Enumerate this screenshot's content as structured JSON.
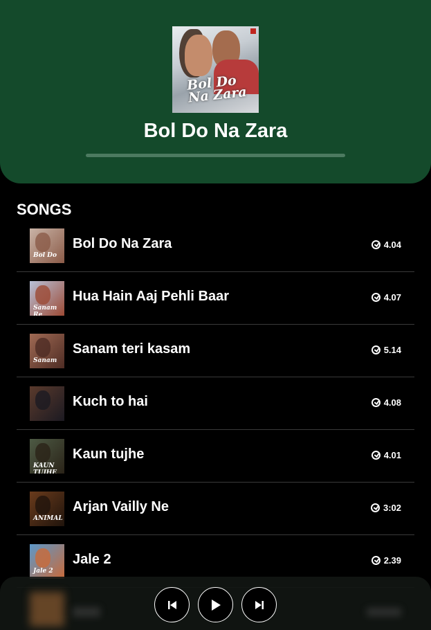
{
  "album": {
    "title": "Bol Do Na Zara",
    "cover_title": "Bol Do Na Zara",
    "progress_fraction": 0.0
  },
  "section": {
    "title": "SONGS"
  },
  "songs": [
    {
      "name": "Bol Do Na Zara",
      "duration": "4.04",
      "thumb_colors": [
        "#c9b3a6",
        "#8b5b48"
      ],
      "thumb_text": "Bol Do"
    },
    {
      "name": "Hua Hain Aaj Pehli Baar",
      "duration": "4.07",
      "thumb_colors": [
        "#b9c1d8",
        "#9c4a35"
      ],
      "thumb_text": "Sanam Re"
    },
    {
      "name": "Sanam teri kasam",
      "duration": "5.14",
      "thumb_colors": [
        "#a06a54",
        "#4e2c24"
      ],
      "thumb_text": "Sanam"
    },
    {
      "name": "Kuch to hai",
      "duration": "4.08",
      "thumb_colors": [
        "#5a3a2c",
        "#1c1a22"
      ],
      "thumb_text": ""
    },
    {
      "name": "Kaun tujhe",
      "duration": "4.01",
      "thumb_colors": [
        "#4d5a44",
        "#2a2318"
      ],
      "thumb_text": "KAUN TUJHE"
    },
    {
      "name": "Arjan Vailly Ne",
      "duration": "3:02",
      "thumb_colors": [
        "#6a3b1c",
        "#20140c"
      ],
      "thumb_text": "ANIMAL"
    },
    {
      "name": "Jale 2",
      "duration": "2.39",
      "thumb_colors": [
        "#5c98c9",
        "#c96a3a"
      ],
      "thumb_text": "Jale 2"
    }
  ],
  "player": {
    "prev_icon": "skip-previous-icon",
    "play_icon": "play-icon",
    "next_icon": "skip-next-icon"
  },
  "colors": {
    "header_bg": "#144a2b",
    "background": "#000000",
    "divider": "#3a3a3a"
  }
}
